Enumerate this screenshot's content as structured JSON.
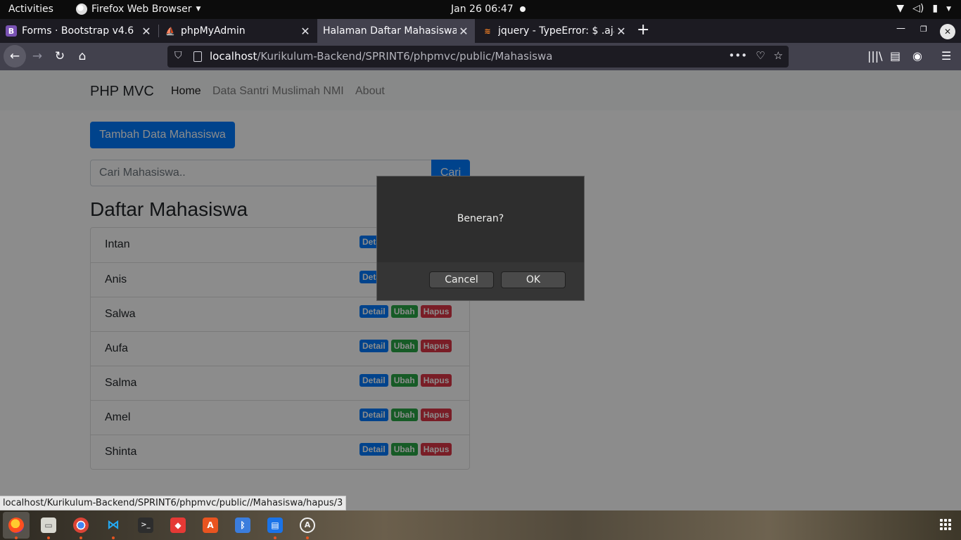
{
  "topbar": {
    "activities": "Activities",
    "app_name": "Firefox Web Browser",
    "clock": "Jan 26  06:47"
  },
  "tabs": [
    {
      "label": "Forms · Bootstrap v4.6",
      "favicon": "bootstrap-icon"
    },
    {
      "label": "phpMyAdmin",
      "favicon": "phpmyadmin-icon"
    },
    {
      "label": "Halaman Daftar Mahasiswa",
      "favicon": "none",
      "active": true
    },
    {
      "label": "jquery - TypeError: $ .ajax",
      "favicon": "stackoverflow-icon"
    }
  ],
  "urlbar": {
    "host": "localhost",
    "path": "/Kurikulum-Backend/SPRINT6/phpmvc/public/Mahasiswa"
  },
  "site": {
    "brand": "PHP MVC",
    "nav": [
      "Home",
      "Data Santri Muslimah NMI",
      "About"
    ],
    "add_button": "Tambah Data Mahasiswa",
    "search_placeholder": "Cari Mahasiswa..",
    "search_button": "Cari",
    "list_title": "Daftar Mahasiswa",
    "badge_labels": {
      "detail": "Detail",
      "edit": "Ubah",
      "delete": "Hapus"
    },
    "students": [
      "Intan",
      "Anis",
      "Salwa",
      "Aufa",
      "Salma",
      "Amel",
      "Shinta"
    ]
  },
  "dialog": {
    "message": "Beneran?",
    "cancel": "Cancel",
    "ok": "OK"
  },
  "status_link": "localhost/Kurikulum-Backend/SPRINT6/phpmvc/public//Mahasiswa/hapus/3",
  "colors": {
    "primary": "#007bff",
    "success": "#28a745",
    "danger": "#dc3545",
    "ubuntu_orange": "#e95420"
  }
}
